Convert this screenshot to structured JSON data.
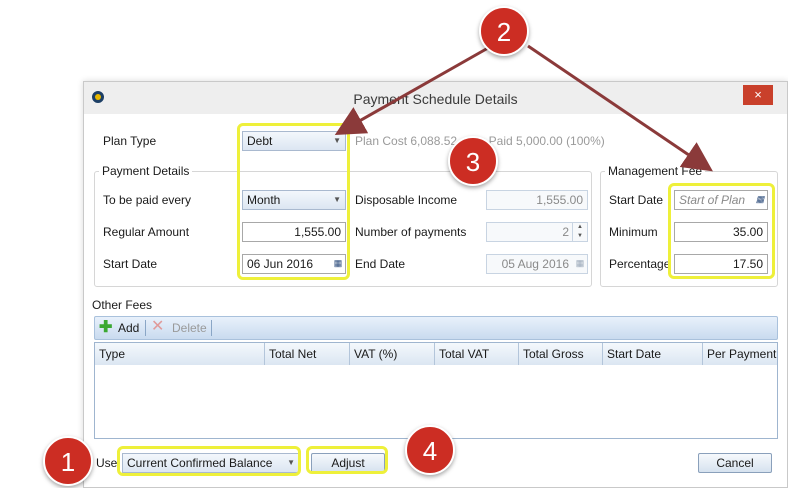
{
  "window": {
    "title": "Payment Schedule Details",
    "close_label": "×"
  },
  "top": {
    "plan_type_label": "Plan Type",
    "plan_type_value": "Debt",
    "plan_cost_text": "Plan Cost 6,088.52",
    "paid_text": ": Paid 5,000.00 (100%)"
  },
  "payment_details": {
    "legend": "Payment Details",
    "paid_every_label": "To be paid every",
    "paid_every_value": "Month",
    "regular_amount_label": "Regular Amount",
    "regular_amount_value": "1,555.00",
    "start_date_label": "Start Date",
    "start_date_value": "06 Jun 2016",
    "disposable_income_label": "Disposable Income",
    "disposable_income_value": "1,555.00",
    "num_payments_label": "Number of payments",
    "num_payments_value": "2",
    "end_date_label": "End Date",
    "end_date_value": "05 Aug 2016"
  },
  "management_fee": {
    "legend": "Management Fee",
    "start_date_label": "Start Date",
    "start_date_placeholder": "Start of Plan",
    "minimum_label": "Minimum",
    "minimum_value": "35.00",
    "percentage_label": "Percentage",
    "percentage_value": "17.50"
  },
  "other_fees": {
    "label": "Other Fees",
    "add_label": "Add",
    "delete_label": "Delete",
    "columns": [
      "Type",
      "Total Net",
      "VAT (%)",
      "Total VAT",
      "Total Gross",
      "Start Date",
      "Per Payment"
    ]
  },
  "footer": {
    "use_label": "Use",
    "use_value": "Current Confirmed Balance",
    "adjust_label": "Adjust",
    "cancel_label": "Cancel"
  },
  "callouts": [
    "1",
    "2",
    "3",
    "4"
  ],
  "colors": {
    "highlight": "#eef03a",
    "badge": "#cc2d23",
    "arrow": "#8b3a3a"
  }
}
